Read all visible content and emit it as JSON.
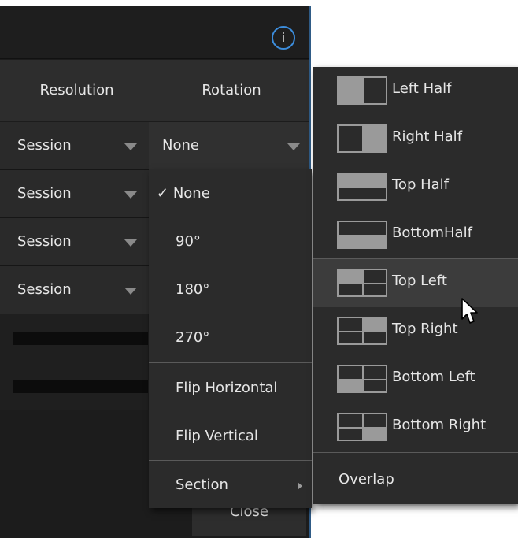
{
  "info_icon": "i",
  "columns": {
    "resolution": "Resolution",
    "rotation": "Rotation"
  },
  "rows": [
    {
      "resolution": "Session",
      "rotation": "None"
    },
    {
      "resolution": "Session"
    },
    {
      "resolution": "Session"
    },
    {
      "resolution": "Session"
    }
  ],
  "close_label": "Close",
  "rotation_menu": {
    "checkmark": "✓",
    "items": [
      "None",
      "90°",
      "180°",
      "270°",
      "Flip Horizontal",
      "Flip Vertical",
      "Section"
    ]
  },
  "section_menu": {
    "items": [
      "Left Half",
      "Right Half",
      "Top Half",
      "BottomHalf",
      "Top Left",
      "Top Right",
      "Bottom Left",
      "Bottom Right"
    ],
    "overlap": "Overlap"
  },
  "icons": {
    "info": "info-icon",
    "dropdown": "triangle-down-icon",
    "submenu": "chevron-right-icon",
    "cursor": "mouse-pointer-icon"
  },
  "colors": {
    "panel": "#1c1c1c",
    "menu": "#2b2b2b",
    "accent": "#3c8ddc",
    "icon_fill": "#9a9a9a"
  }
}
